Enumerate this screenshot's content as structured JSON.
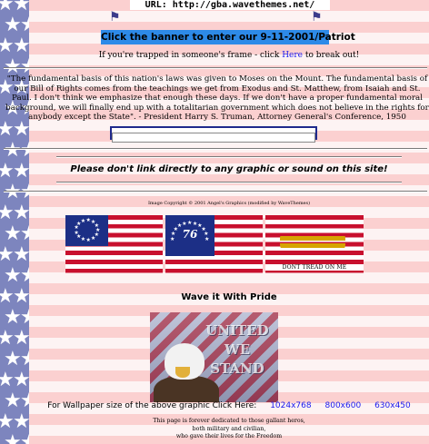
{
  "header": {
    "url_label": "URL: http://gba.wavethemes.net/",
    "banner_link": "Click the banner to enter our 9-11-2001/Patriot",
    "frame_msg_before": "If you're trapped in someone's frame - click ",
    "frame_msg_link": "Here",
    "frame_msg_after": " to break out!"
  },
  "quote": {
    "text": "\"The fundamental basis of this nation's laws was given to Moses on the Mount. The fundamental basis of our Bill of Rights comes from the teachings we get from Exodus and St. Matthew, from Isaiah and St. Paul. I don't think we emphasize that enough these days. If we don't have a proper fundamental moral background, we will finally end up with a totalitarian government which does not believe in the rights for anybody except the State\". - President Harry S. Truman, Attorney General's Conference, 1950"
  },
  "notice": "Please don't link directly to any graphic or sound on this site!",
  "copyright": "Image Copyright © 2001 Angel's Graphics (modified by WaveThemes)",
  "flags": {
    "third_flag_motto": "DONT TREAD ON ME",
    "second_flag_number": "76"
  },
  "wave_title": "Wave it With Pride",
  "eagle_image_text": [
    "UNITED",
    "WE",
    "STAND"
  ],
  "wallpaper": {
    "prefix": "For Wallpaper size of the above graphic Click Here:",
    "links": [
      "1024x768",
      "800x600",
      "630x450"
    ]
  },
  "dedication": [
    "This page is forever dedicated to those gallant heros,",
    "both military and civilian,",
    "who gave their lives for the Freedom"
  ],
  "colors": {
    "banner_bg": "#2d8ae8",
    "link": "#1a1aee",
    "stripe_red": "#fbd0d0",
    "star_band": "#7d85be"
  }
}
